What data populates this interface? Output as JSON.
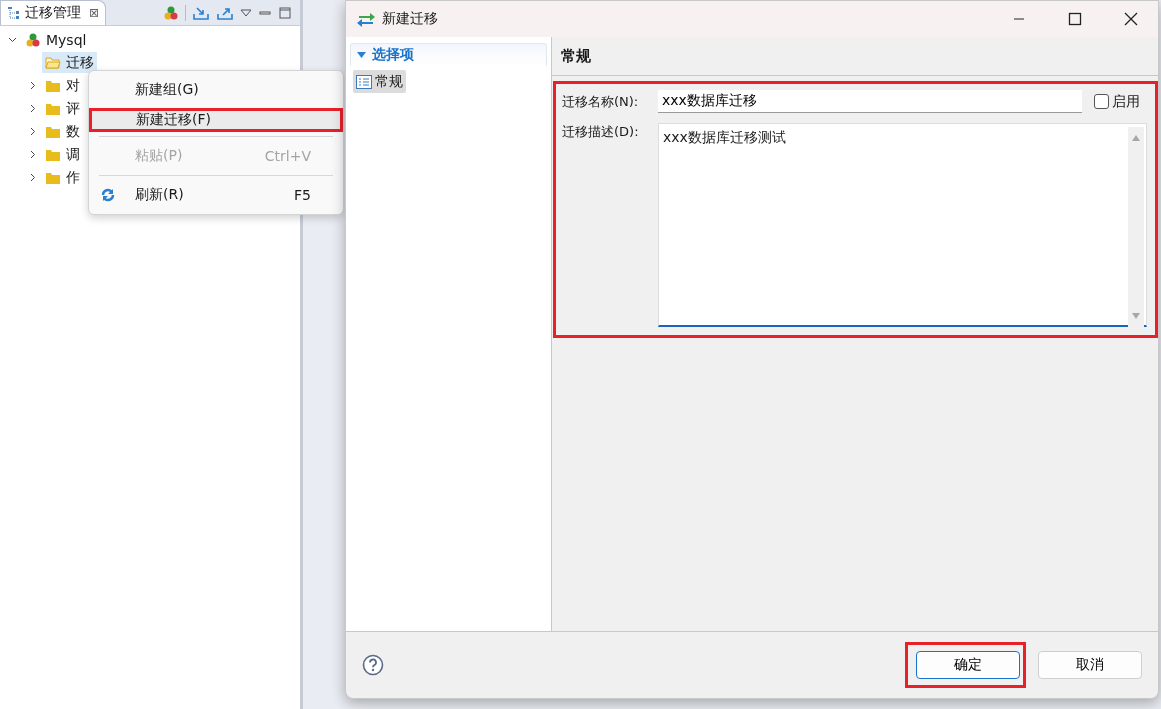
{
  "view": {
    "tab": {
      "title": "迁移管理",
      "close": "⊠",
      "selected": true
    },
    "tree": [
      {
        "label": "Mysql",
        "kind": "database",
        "expanded": true,
        "children": [
          {
            "label": "迁移",
            "kind": "folder",
            "selected": true
          },
          {
            "label": "对",
            "kind": "folder",
            "expanded": false
          },
          {
            "label": "评",
            "kind": "folder",
            "expanded": false
          },
          {
            "label": "数",
            "kind": "folder",
            "expanded": false
          },
          {
            "label": "调",
            "kind": "folder",
            "expanded": false
          },
          {
            "label": "作",
            "kind": "folder",
            "expanded": false
          }
        ]
      }
    ]
  },
  "context_menu": [
    {
      "kind": "item",
      "label": "新建组(G)",
      "disabled": false,
      "highlighted": false
    },
    {
      "kind": "item",
      "label": "新建迁移(F)",
      "disabled": false,
      "highlighted": true
    },
    {
      "kind": "separator"
    },
    {
      "kind": "item",
      "label": "粘贴(P)",
      "shortcut": "Ctrl+V",
      "disabled": true,
      "highlighted": false
    },
    {
      "kind": "separator"
    },
    {
      "kind": "refresh_item",
      "label": "刷新(R)",
      "shortcut": "F5",
      "disabled": false,
      "highlighted": false
    }
  ],
  "dialog": {
    "title": "新建迁移",
    "nav": {
      "header": "选择项",
      "items": [
        {
          "label": "常规",
          "selected": true
        }
      ]
    },
    "page_title": "常规",
    "form": {
      "highlighted": true,
      "name": {
        "label": "迁移名称(N):",
        "value": "xxx数据库迁移"
      },
      "enabled": {
        "label": "启用",
        "checked": false
      },
      "description": {
        "label": "迁移描述(D):",
        "value": "xxx数据库迁移测试"
      }
    },
    "buttons": [
      {
        "label": "确定",
        "kind": "primary",
        "highlighted": true
      },
      {
        "label": "取消",
        "kind": "secondary",
        "highlighted": false
      }
    ]
  }
}
